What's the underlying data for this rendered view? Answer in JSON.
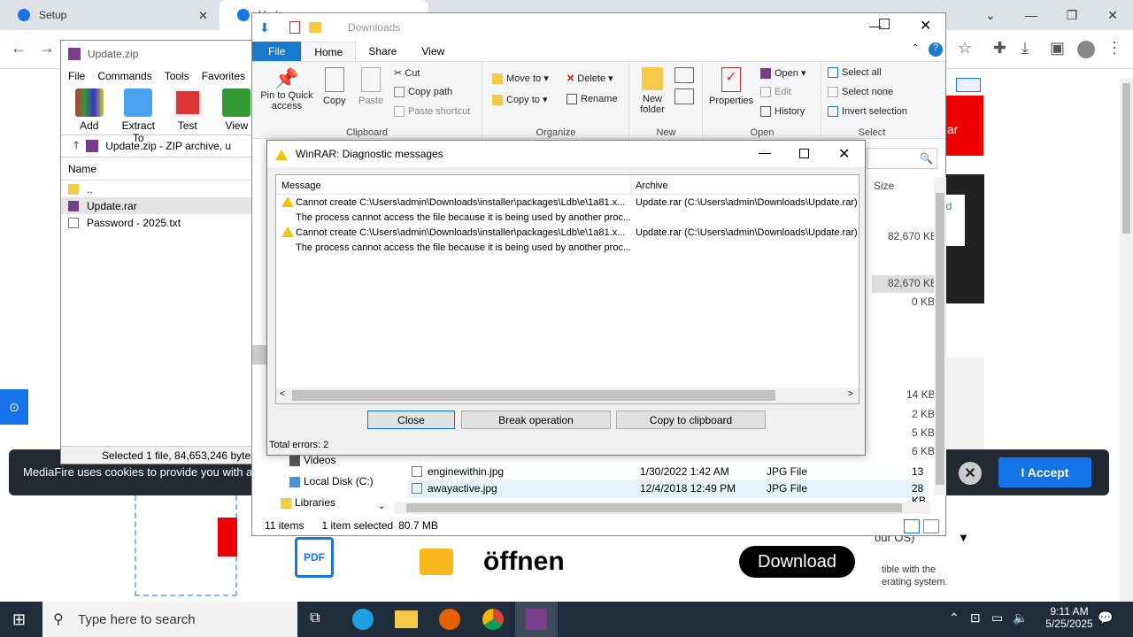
{
  "browser": {
    "tabs": [
      {
        "label": "Setup"
      },
      {
        "label": "Upd"
      }
    ],
    "close_glyph": "✕"
  },
  "winrar": {
    "title": "Update.zip",
    "menu": [
      "File",
      "Commands",
      "Tools",
      "Favorites"
    ],
    "tools": [
      {
        "label": "Add",
        "icon": "add-archive-icon"
      },
      {
        "label": "Extract To",
        "icon": "extract-icon"
      },
      {
        "label": "Test",
        "icon": "test-icon"
      },
      {
        "label": "View",
        "icon": "view-icon"
      }
    ],
    "path": "Update.zip - ZIP archive, u",
    "column_name": "Name",
    "files": [
      {
        "name": ".."
      },
      {
        "name": "Update.rar"
      },
      {
        "name": "Password - 2025.txt"
      }
    ],
    "status": "Selected 1 file, 84,653,246 bytes"
  },
  "explorer": {
    "title": "Downloads",
    "tabs": [
      "File",
      "Home",
      "Share",
      "View"
    ],
    "ribbon": {
      "pin": "Pin to Quick access",
      "copy": "Copy",
      "paste": "Paste",
      "cut": "Cut",
      "copy_path": "Copy path",
      "paste_shortcut": "Paste shortcut",
      "clipboard": "Clipboard",
      "move_to": "Move to",
      "copy_to": "Copy to",
      "delete": "Delete",
      "rename": "Rename",
      "organize": "Organize",
      "new_folder": "New folder",
      "new": "New",
      "properties": "Properties",
      "open": "Open",
      "edit": "Edit",
      "history": "History",
      "open_group": "Open",
      "select_all": "Select all",
      "select_none": "Select none",
      "invert_selection": "Invert selection",
      "select": "Select"
    },
    "size_header": "Size",
    "sizes": [
      "82,670 KB",
      "82,670 KB",
      "0 KB",
      "14 KB",
      "2 KB",
      "5 KB",
      "6 KB",
      "13 KB",
      "28 KB"
    ],
    "nav": [
      "Videos",
      "Local Disk (C:)",
      "Libraries"
    ],
    "files": [
      {
        "name": "enginewithin.jpg",
        "date": "1/30/2022 1:42 AM",
        "type": "JPG File",
        "size": "13 KB"
      },
      {
        "name": "awayactive.jpg",
        "date": "12/4/2018 12:49 PM",
        "type": "JPG File",
        "size": "28 KB"
      }
    ],
    "status_items": "11 items",
    "status_selected": "1 item selected",
    "status_size": "80.7 MB"
  },
  "dialog": {
    "title": "WinRAR: Diagnostic messages",
    "col_message": "Message",
    "col_archive": "Archive",
    "rows": [
      {
        "message": "Cannot create C:\\Users\\admin\\Downloads\\installer\\packages\\Ldb\\e\\1a81.x...",
        "detail": "The process cannot access the file because it is being used by another proc...",
        "archive": "Update.rar (C:\\Users\\admin\\Downloads\\Update.rar)"
      },
      {
        "message": "Cannot create C:\\Users\\admin\\Downloads\\installer\\packages\\Ldb\\e\\1a81.x...",
        "detail": "The process cannot access the file because it is being used by another proc...",
        "archive": "Update.rar (C:\\Users\\admin\\Downloads\\Update.rar)"
      }
    ],
    "close": "Close",
    "break": "Break operation",
    "copy": "Copy to clipboard",
    "total": "Total errors: 2"
  },
  "webpage": {
    "cookie_text": "MediaFire uses cookies to provide you with a",
    "accept": "I Accept",
    "offnen": "öffnen",
    "download": "Download",
    "pdf_label": "PDF",
    "right_text1": "our OS)",
    "right_text2": "tible with the",
    "right_text3": "erating system.",
    "ad_label": "ar",
    "ad_label2": "ad"
  },
  "taskbar": {
    "search_placeholder": "Type here to search",
    "time": "9:11 AM",
    "date": "5/25/2025"
  },
  "colors": {
    "accent": "#1979ca",
    "cookie_bg": "#222933",
    "accept": "#1473e6",
    "taskbar": "#1f2d3a"
  }
}
